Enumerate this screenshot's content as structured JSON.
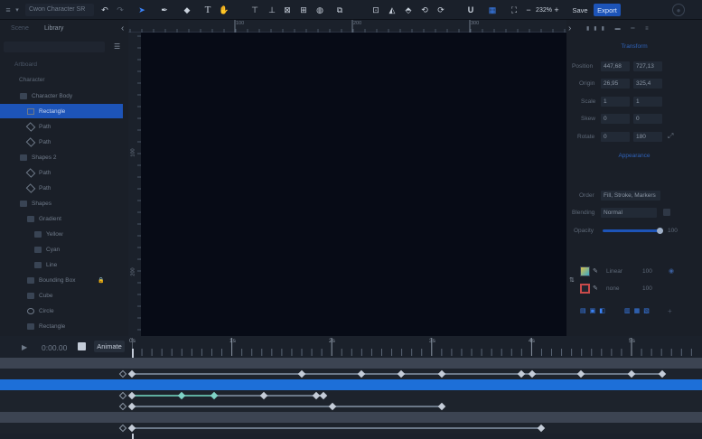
{
  "toolbar": {
    "doc_title": "Cwon Character SR",
    "zoom": "232%",
    "save": "Save",
    "export": "Export"
  },
  "left_panel": {
    "tabs": [
      "Scene",
      "Library"
    ],
    "tree": [
      {
        "label": "Character Body",
        "icon": "folder-icon",
        "indent": 1
      },
      {
        "label": "Rectangle",
        "icon": "rectangle-icon",
        "indent": 2,
        "selected": true
      },
      {
        "label": "Path",
        "icon": "path-icon",
        "indent": 2
      },
      {
        "label": "Path",
        "icon": "path-icon",
        "indent": 2
      },
      {
        "label": "Shapes 2",
        "icon": "folder-icon",
        "indent": 1
      },
      {
        "label": "Path",
        "icon": "path-icon",
        "indent": 2
      },
      {
        "label": "Path",
        "icon": "path-icon",
        "indent": 2
      },
      {
        "label": "Shapes",
        "icon": "folder-icon",
        "indent": 1
      },
      {
        "label": "Gradient",
        "icon": "folder-icon",
        "indent": 2
      },
      {
        "label": "Yellow",
        "icon": "folder-icon",
        "indent": 3
      },
      {
        "label": "Cyan",
        "icon": "folder-icon",
        "indent": 3
      },
      {
        "label": "Line",
        "icon": "folder-icon",
        "indent": 3
      },
      {
        "label": "Bounding Box",
        "icon": "folder-icon",
        "indent": 2,
        "locked": true
      },
      {
        "label": "Cube",
        "icon": "folder-icon",
        "indent": 2
      },
      {
        "label": "Circle",
        "icon": "circle-icon",
        "indent": 2
      },
      {
        "label": "Rectangle",
        "icon": "folder-icon",
        "indent": 2
      }
    ]
  },
  "rulers": {
    "top": [
      "100",
      "200",
      "300"
    ],
    "left": [
      "100",
      "200"
    ]
  },
  "right_panel": {
    "transform_title": "Transform",
    "position_label": "Position",
    "position_x": "447,68",
    "position_y": "727,13",
    "origin_label": "Origin",
    "origin_x": "26,95",
    "origin_y": "325,4",
    "scale_label": "Scale",
    "scale_x": "1",
    "scale_y": "1",
    "skew_label": "Skew",
    "skew_x": "0",
    "skew_y": "0",
    "rotate_label": "Rotate",
    "rotate_x": "0",
    "rotate_y": "180",
    "appearance_title": "Appearance",
    "order_label": "Order",
    "order_value": "Fill, Stroke, Markers",
    "blending_label": "Blending",
    "blending_value": "Normal",
    "opacity_label": "Opacity",
    "opacity_value": "100",
    "fill_label": "Linear",
    "fill_opacity": "100",
    "stroke_label": "none",
    "stroke_opacity": "100"
  },
  "timeline": {
    "time": "0:00.00",
    "animate": "Animate",
    "time_markers": [
      "0s",
      "1s",
      "2s",
      "3s",
      "4s",
      "5s"
    ]
  },
  "colors": {
    "accent": "#1d54b8",
    "canvas": "#070b16",
    "panel": "#1a1f28"
  }
}
